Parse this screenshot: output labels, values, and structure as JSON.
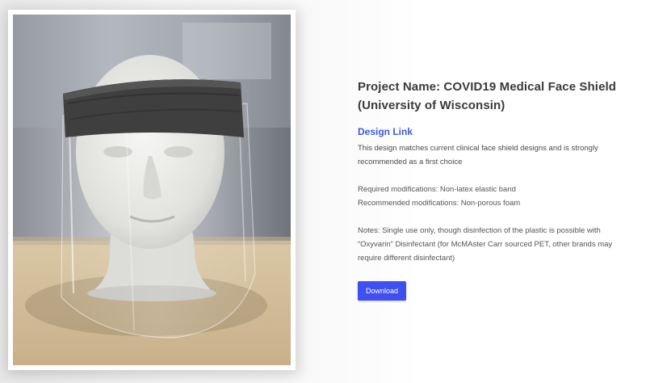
{
  "project": {
    "title": "Project Name: COVID19 Medical Face Shield (University of Wisconsin)",
    "design_link": "Design Link",
    "description": "This design matches current clinical face shield designs and is strongly recommended as a first choice",
    "required_mods": "Required modifications: Non-latex elastic band",
    "recommended_mods": "Recommended modifications: Non-porous foam",
    "notes": "Notes: Single use only, though disinfection of the plastic is possible with “Oxyvarin” Disinfectant (for McMAster Carr sourced PET, other brands may require different disinfectant)",
    "download_label": "Download"
  },
  "colors": {
    "accent": "#3f4ff0",
    "link": "#3b5bdb",
    "title": "#3a3a3a"
  },
  "icons": {
    "photo": "face-shield-on-mannequin-photo"
  }
}
